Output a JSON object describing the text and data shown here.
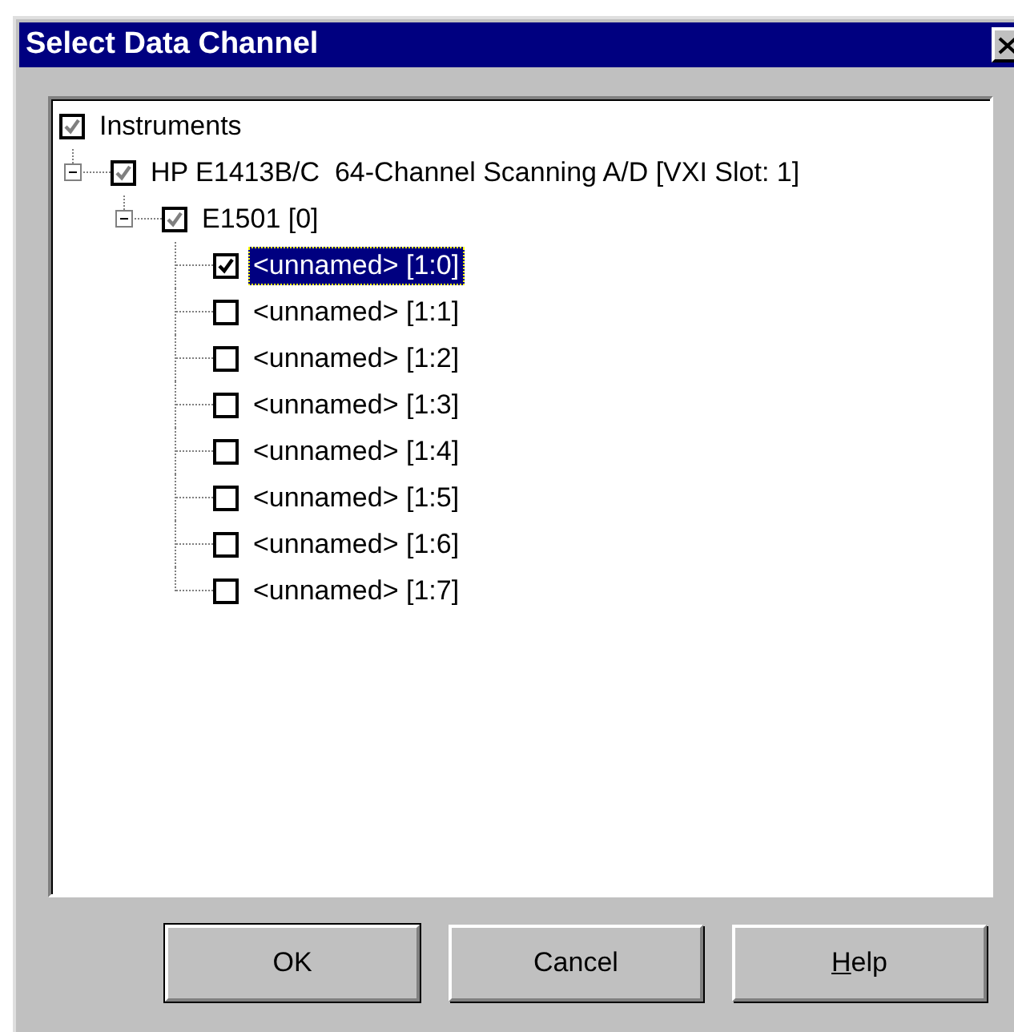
{
  "window": {
    "title": "Select Data Channel"
  },
  "tree": {
    "items": [
      {
        "label": "Instruments",
        "checked": true,
        "partial": true,
        "selected": false,
        "children": [
          {
            "label": "HP E1413B/C  64-Channel Scanning A/D [VXI Slot: 1]",
            "checked": true,
            "partial": true,
            "selected": false,
            "expanded": true,
            "children": [
              {
                "label": "E1501 [0]",
                "checked": true,
                "partial": true,
                "selected": false,
                "expanded": true,
                "children": [
                  {
                    "label": "<unnamed> [1:0]",
                    "checked": true,
                    "selected": true
                  },
                  {
                    "label": "<unnamed> [1:1]",
                    "checked": false,
                    "selected": false
                  },
                  {
                    "label": "<unnamed> [1:2]",
                    "checked": false,
                    "selected": false
                  },
                  {
                    "label": "<unnamed> [1:3]",
                    "checked": false,
                    "selected": false
                  },
                  {
                    "label": "<unnamed> [1:4]",
                    "checked": false,
                    "selected": false
                  },
                  {
                    "label": "<unnamed> [1:5]",
                    "checked": false,
                    "selected": false
                  },
                  {
                    "label": "<unnamed> [1:6]",
                    "checked": false,
                    "selected": false
                  },
                  {
                    "label": "<unnamed> [1:7]",
                    "checked": false,
                    "selected": false
                  }
                ]
              }
            ]
          }
        ]
      }
    ]
  },
  "buttons": [
    {
      "label": "OK",
      "default": true
    },
    {
      "label": "Cancel",
      "default": false
    },
    {
      "label": "Help",
      "default": false,
      "mnemonic_underlined": true
    }
  ]
}
